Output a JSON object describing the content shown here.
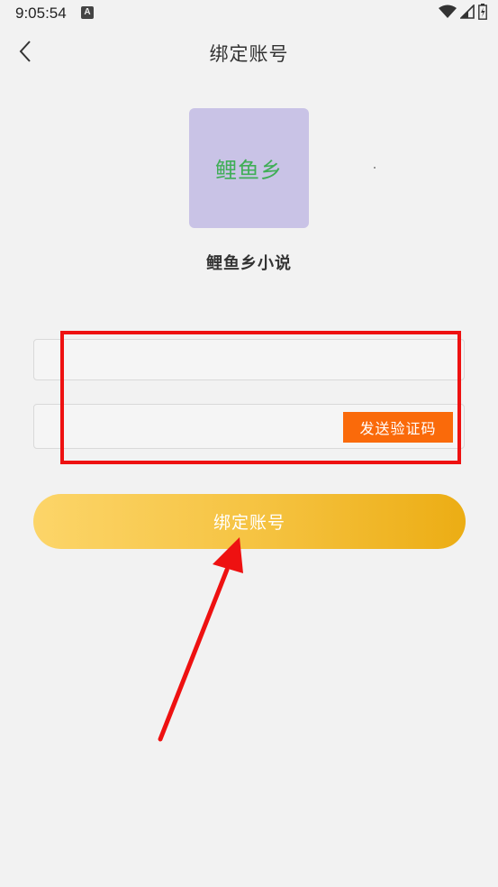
{
  "status_bar": {
    "time": "9:05:54",
    "notification_icon_letter": "A",
    "icons": [
      "wifi-icon",
      "signal-icon",
      "battery-icon"
    ]
  },
  "header": {
    "title": "绑定账号",
    "back_icon": "chevron-left-icon"
  },
  "logo": {
    "text": "鲤鱼乡",
    "background_color": "#c9c3e6",
    "text_color": "#3fae56"
  },
  "app": {
    "name": "鲤鱼乡小说"
  },
  "form": {
    "phone_input": {
      "value": "",
      "placeholder": ""
    },
    "code_input": {
      "value": "",
      "placeholder": ""
    },
    "send_code_label": "发送验证码",
    "send_code_color": "#fa6a0a",
    "bind_button_label": "绑定账号"
  },
  "annotation": {
    "highlight_color": "#ee1111",
    "arrow_color": "#ee1111"
  }
}
